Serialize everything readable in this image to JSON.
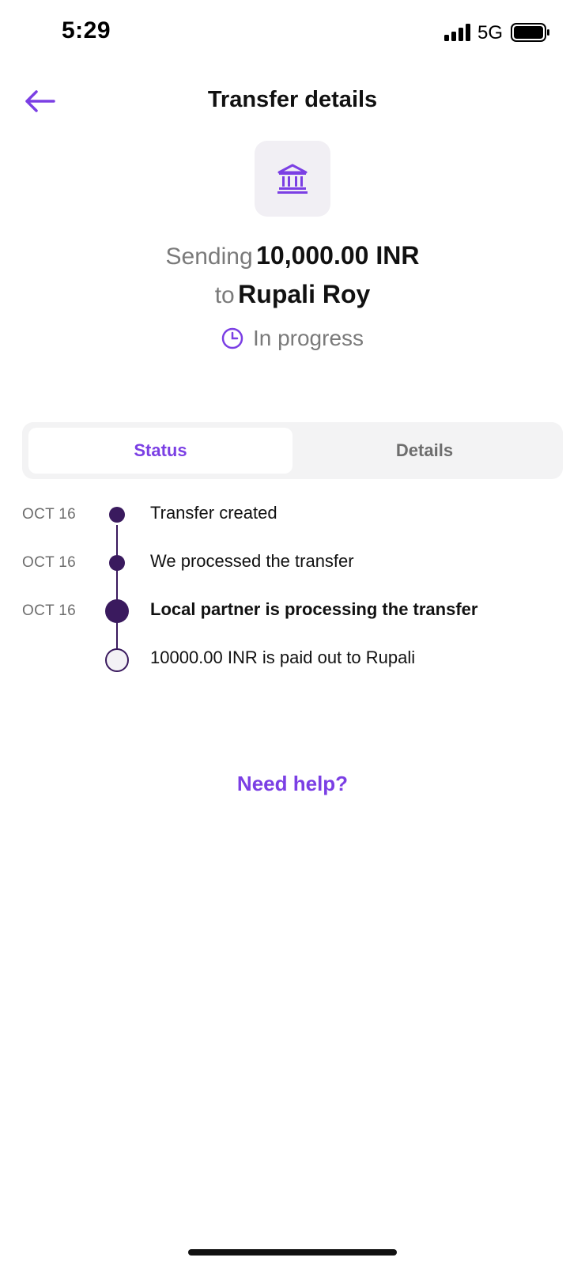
{
  "status_bar": {
    "time": "5:29",
    "network": "5G"
  },
  "header": {
    "title": "Transfer details",
    "back_icon": "arrow-left-icon"
  },
  "transfer": {
    "icon": "bank-icon",
    "sending_prefix": "Sending",
    "amount": "10,000.00 INR",
    "to_prefix": "to",
    "recipient": "Rupali Roy",
    "status_icon": "clock-icon",
    "status": "In progress"
  },
  "tabs": [
    {
      "label": "Status",
      "active": true
    },
    {
      "label": "Details",
      "active": false
    }
  ],
  "timeline": [
    {
      "date": "OCT 16",
      "text": "Transfer created",
      "state": "done"
    },
    {
      "date": "OCT 16",
      "text": "We processed the transfer",
      "state": "done"
    },
    {
      "date": "OCT 16",
      "text": "Local partner is processing the transfer",
      "state": "current"
    },
    {
      "date": "",
      "text": "10000.00 INR is paid out to Rupali",
      "state": "pending"
    }
  ],
  "help": {
    "label": "Need help?"
  },
  "colors": {
    "accent": "#7b3fe4",
    "timeline": "#3a1a5e",
    "muted": "#7a7a7a"
  }
}
